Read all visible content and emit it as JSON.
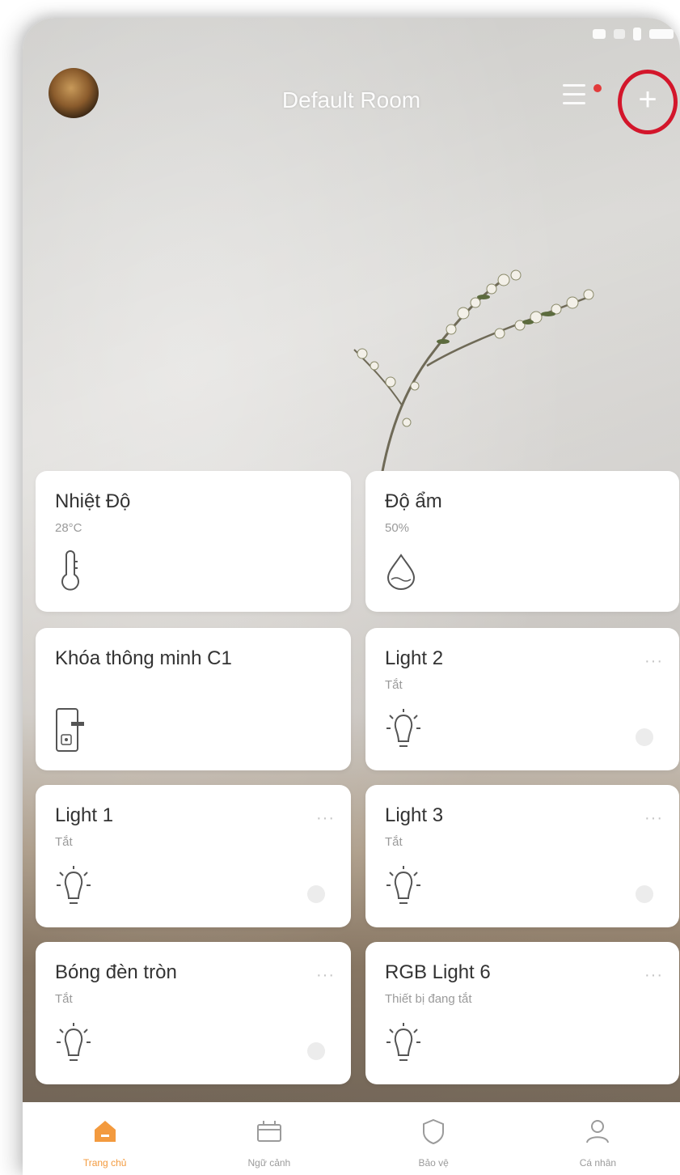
{
  "header": {
    "title": "Default Room",
    "avatar_icon": "user-avatar",
    "menu_icon": "menu-icon",
    "add_icon": "plus-icon",
    "notification_color": "#e23b3b",
    "highlight_color": "#d3162b"
  },
  "devices": [
    {
      "name": "Nhiệt Độ",
      "status": "28°C",
      "icon": "thermometer-icon"
    },
    {
      "name": "Độ ẩm",
      "status": "50%",
      "icon": "humidity-drop-icon"
    },
    {
      "name": "Khóa thông minh C1",
      "status": "",
      "icon": "smart-lock-icon"
    },
    {
      "name": "Light 2",
      "status": "Tắt",
      "icon": "bulb-icon",
      "more": "···"
    },
    {
      "name": "Light 1",
      "status": "Tắt",
      "icon": "bulb-icon",
      "more": "···"
    },
    {
      "name": "Light 3",
      "status": "Tắt",
      "icon": "bulb-icon",
      "more": "···"
    },
    {
      "name": "Bóng đèn tròn",
      "status": "Tắt",
      "icon": "bulb-icon",
      "more": "···"
    },
    {
      "name": "RGB Light 6",
      "status": "Thiết bị đang tắt",
      "icon": "bulb-icon",
      "more": "···"
    }
  ],
  "tabs": [
    {
      "label": "Trang chủ",
      "icon": "home-icon",
      "active": true
    },
    {
      "label": "Ngữ cảnh",
      "icon": "scene-icon",
      "active": false
    },
    {
      "label": "Bảo vệ",
      "icon": "shield-icon",
      "active": false
    },
    {
      "label": "Cá nhân",
      "icon": "person-icon",
      "active": false
    }
  ],
  "colors": {
    "accent": "#f39a3e",
    "card": "#ffffff",
    "muted_text": "#9a9a9a"
  }
}
